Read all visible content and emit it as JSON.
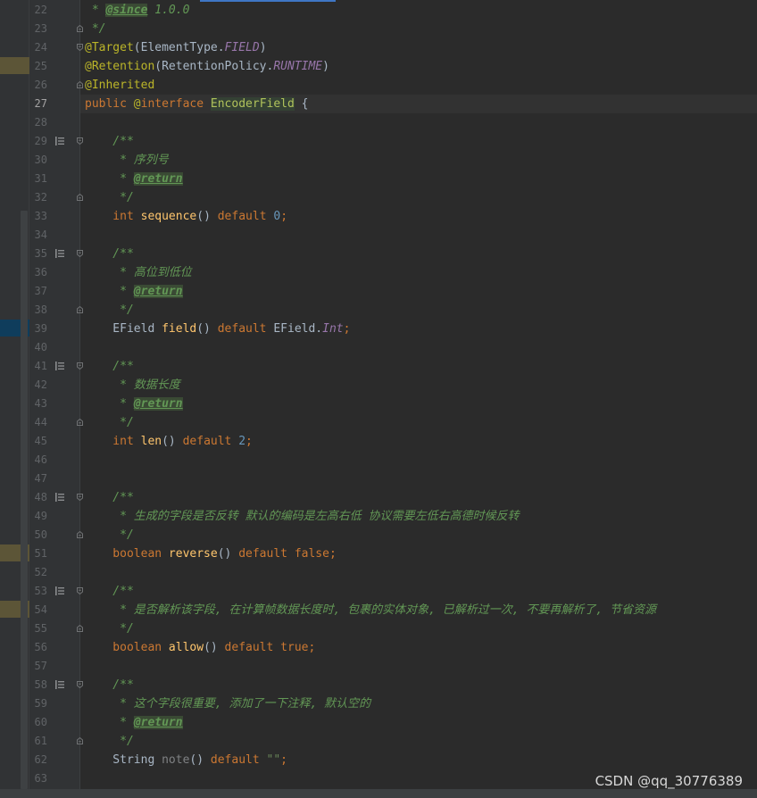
{
  "editor": {
    "lines": [
      {
        "n": "22",
        "current": false,
        "gicon": "",
        "fold": "",
        "tokens": [
          [
            "doc",
            " * "
          ],
          [
            "doctag",
            "@since"
          ],
          [
            "doc",
            " 1.0.0"
          ]
        ]
      },
      {
        "n": "23",
        "current": false,
        "gicon": "",
        "fold": "end",
        "tokens": [
          [
            "doc",
            " */"
          ]
        ]
      },
      {
        "n": "24",
        "current": false,
        "gicon": "",
        "fold": "start",
        "tokens": [
          [
            "anno",
            "@Target"
          ],
          [
            "plain",
            "(ElementType."
          ],
          [
            "enumc",
            "FIELD"
          ],
          [
            "plain",
            ")"
          ]
        ]
      },
      {
        "n": "25",
        "current": false,
        "gicon": "",
        "fold": "",
        "tokens": [
          [
            "anno",
            "@Retention"
          ],
          [
            "plain",
            "(RetentionPolicy."
          ],
          [
            "enumc",
            "RUNTIME"
          ],
          [
            "plain",
            ")"
          ]
        ]
      },
      {
        "n": "26",
        "current": false,
        "gicon": "",
        "fold": "end",
        "tokens": [
          [
            "anno",
            "@Inherited"
          ]
        ]
      },
      {
        "n": "27",
        "current": true,
        "gicon": "",
        "fold": "",
        "tokens": [
          [
            "kw",
            "public "
          ],
          [
            "anno",
            "@"
          ],
          [
            "kw",
            "interface "
          ],
          [
            "iface",
            "EncoderField"
          ],
          [
            "plain",
            " {"
          ]
        ]
      },
      {
        "n": "28",
        "current": false,
        "gicon": "",
        "fold": "",
        "tokens": []
      },
      {
        "n": "29",
        "current": false,
        "gicon": "doc",
        "fold": "start",
        "tokens": [
          [
            "doc",
            "    /**"
          ]
        ]
      },
      {
        "n": "30",
        "current": false,
        "gicon": "",
        "fold": "",
        "tokens": [
          [
            "doc",
            "     * 序列号"
          ]
        ]
      },
      {
        "n": "31",
        "current": false,
        "gicon": "",
        "fold": "",
        "tokens": [
          [
            "doc",
            "     * "
          ],
          [
            "doctag",
            "@return"
          ]
        ]
      },
      {
        "n": "32",
        "current": false,
        "gicon": "",
        "fold": "end",
        "tokens": [
          [
            "doc",
            "     */"
          ]
        ]
      },
      {
        "n": "33",
        "current": false,
        "gicon": "",
        "fold": "",
        "tokens": [
          [
            "kw",
            "    int "
          ],
          [
            "fn",
            "sequence"
          ],
          [
            "plain",
            "() "
          ],
          [
            "kw",
            "default "
          ],
          [
            "num",
            "0"
          ],
          [
            "kw",
            ";"
          ]
        ]
      },
      {
        "n": "34",
        "current": false,
        "gicon": "",
        "fold": "",
        "tokens": []
      },
      {
        "n": "35",
        "current": false,
        "gicon": "doc",
        "fold": "start",
        "tokens": [
          [
            "doc",
            "    /**"
          ]
        ]
      },
      {
        "n": "36",
        "current": false,
        "gicon": "",
        "fold": "",
        "tokens": [
          [
            "doc",
            "     * 高位到低位"
          ]
        ]
      },
      {
        "n": "37",
        "current": false,
        "gicon": "",
        "fold": "",
        "tokens": [
          [
            "doc",
            "     * "
          ],
          [
            "doctag",
            "@return"
          ]
        ]
      },
      {
        "n": "38",
        "current": false,
        "gicon": "",
        "fold": "end",
        "tokens": [
          [
            "doc",
            "     */"
          ]
        ]
      },
      {
        "n": "39",
        "current": false,
        "gicon": "",
        "fold": "",
        "tokens": [
          [
            "plain",
            "    EField "
          ],
          [
            "fn",
            "field"
          ],
          [
            "plain",
            "() "
          ],
          [
            "kw",
            "default "
          ],
          [
            "plain",
            "EField."
          ],
          [
            "enumc",
            "Int"
          ],
          [
            "kw",
            ";"
          ]
        ]
      },
      {
        "n": "40",
        "current": false,
        "gicon": "",
        "fold": "",
        "tokens": []
      },
      {
        "n": "41",
        "current": false,
        "gicon": "doc",
        "fold": "start",
        "tokens": [
          [
            "doc",
            "    /**"
          ]
        ]
      },
      {
        "n": "42",
        "current": false,
        "gicon": "",
        "fold": "",
        "tokens": [
          [
            "doc",
            "     * 数据长度"
          ]
        ]
      },
      {
        "n": "43",
        "current": false,
        "gicon": "",
        "fold": "",
        "tokens": [
          [
            "doc",
            "     * "
          ],
          [
            "doctag",
            "@return"
          ]
        ]
      },
      {
        "n": "44",
        "current": false,
        "gicon": "",
        "fold": "end",
        "tokens": [
          [
            "doc",
            "     */"
          ]
        ]
      },
      {
        "n": "45",
        "current": false,
        "gicon": "",
        "fold": "",
        "tokens": [
          [
            "kw",
            "    int "
          ],
          [
            "fn",
            "len"
          ],
          [
            "plain",
            "() "
          ],
          [
            "kw",
            "default "
          ],
          [
            "num",
            "2"
          ],
          [
            "kw",
            ";"
          ]
        ]
      },
      {
        "n": "46",
        "current": false,
        "gicon": "",
        "fold": "",
        "tokens": []
      },
      {
        "n": "47",
        "current": false,
        "gicon": "",
        "fold": "",
        "tokens": []
      },
      {
        "n": "48",
        "current": false,
        "gicon": "doc",
        "fold": "start",
        "tokens": [
          [
            "doc",
            "    /**"
          ]
        ]
      },
      {
        "n": "49",
        "current": false,
        "gicon": "",
        "fold": "",
        "tokens": [
          [
            "doc",
            "     * 生成的字段是否反转 默认的编码是左高右低 协议需要左低右高德时候反转"
          ]
        ]
      },
      {
        "n": "50",
        "current": false,
        "gicon": "",
        "fold": "end",
        "tokens": [
          [
            "doc",
            "     */"
          ]
        ]
      },
      {
        "n": "51",
        "current": false,
        "gicon": "",
        "fold": "",
        "tokens": [
          [
            "kw",
            "    boolean "
          ],
          [
            "fn",
            "reverse"
          ],
          [
            "plain",
            "() "
          ],
          [
            "kw",
            "default false;"
          ]
        ]
      },
      {
        "n": "52",
        "current": false,
        "gicon": "",
        "fold": "",
        "tokens": []
      },
      {
        "n": "53",
        "current": false,
        "gicon": "doc",
        "fold": "start",
        "tokens": [
          [
            "doc",
            "    /**"
          ]
        ]
      },
      {
        "n": "54",
        "current": false,
        "gicon": "",
        "fold": "",
        "tokens": [
          [
            "doc",
            "     * 是否解析该字段, 在计算帧数据长度时, 包裹的实体对象, 已解析过一次, 不要再解析了, 节省资源"
          ]
        ]
      },
      {
        "n": "55",
        "current": false,
        "gicon": "",
        "fold": "end",
        "tokens": [
          [
            "doc",
            "     */"
          ]
        ]
      },
      {
        "n": "56",
        "current": false,
        "gicon": "",
        "fold": "",
        "tokens": [
          [
            "kw",
            "    boolean "
          ],
          [
            "fn",
            "allow"
          ],
          [
            "plain",
            "() "
          ],
          [
            "kw",
            "default true;"
          ]
        ]
      },
      {
        "n": "57",
        "current": false,
        "gicon": "",
        "fold": "",
        "tokens": []
      },
      {
        "n": "58",
        "current": false,
        "gicon": "doc",
        "fold": "start",
        "tokens": [
          [
            "doc",
            "    /**"
          ]
        ]
      },
      {
        "n": "59",
        "current": false,
        "gicon": "",
        "fold": "",
        "tokens": [
          [
            "doc",
            "     * 这个字段很重要, 添加了一下注释, 默认空的"
          ]
        ]
      },
      {
        "n": "60",
        "current": false,
        "gicon": "",
        "fold": "",
        "tokens": [
          [
            "doc",
            "     * "
          ],
          [
            "doctag",
            "@return"
          ]
        ]
      },
      {
        "n": "61",
        "current": false,
        "gicon": "",
        "fold": "end",
        "tokens": [
          [
            "doc",
            "     */"
          ]
        ]
      },
      {
        "n": "62",
        "current": false,
        "gicon": "",
        "fold": "",
        "tokens": [
          [
            "plain",
            "    String "
          ],
          [
            "unused",
            "note"
          ],
          [
            "plain",
            "() "
          ],
          [
            "kw",
            "default "
          ],
          [
            "str",
            "\"\""
          ],
          [
            "kw",
            ";"
          ]
        ]
      },
      {
        "n": "63",
        "current": false,
        "gicon": "",
        "fold": "",
        "tokens": []
      }
    ]
  },
  "left_strip_marks": [
    {
      "line": 3,
      "color": "#5c5537"
    },
    {
      "line": 17,
      "color": "#0f3d5c"
    },
    {
      "line": 29,
      "color": "#5c5537"
    },
    {
      "line": 32,
      "color": "#5c5537"
    }
  ],
  "watermark": "CSDN @qq_30776389"
}
